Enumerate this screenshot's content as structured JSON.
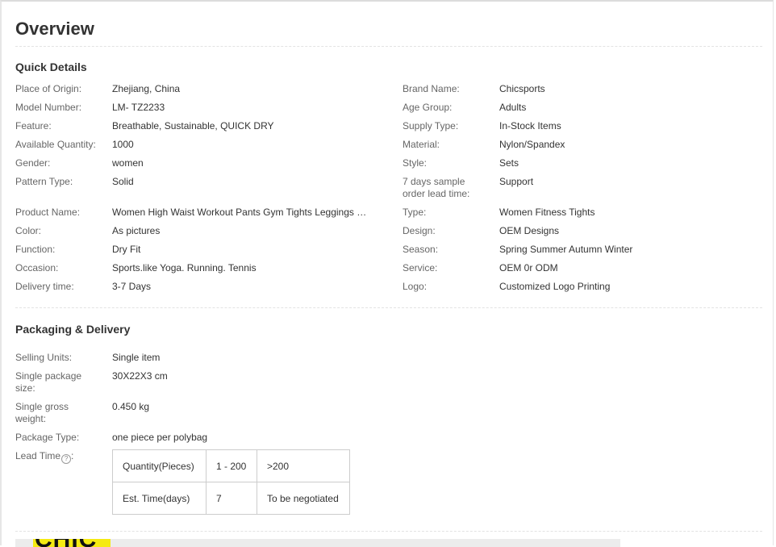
{
  "title": "Overview",
  "quick_details": {
    "heading": "Quick Details",
    "left": [
      {
        "label": "Place of Origin:",
        "value": "Zhejiang, China"
      },
      {
        "label": "Model Number:",
        "value": "LM- TZ2233"
      },
      {
        "label": "Feature:",
        "value": "Breathable, Sustainable, QUICK DRY"
      },
      {
        "label": "Available Quantity:",
        "value": "1000"
      },
      {
        "label": "Gender:",
        "value": "women"
      },
      {
        "label": "Pattern Type:",
        "value": "Solid"
      },
      {
        "label": "Product Name:",
        "value": "Women High Waist Workout Pants Gym Tights Leggings With Pocket"
      },
      {
        "label": "Color:",
        "value": "As pictures"
      },
      {
        "label": "Function:",
        "value": "Dry Fit"
      },
      {
        "label": "Occasion:",
        "value": "Sports.like Yoga. Running. Tennis"
      },
      {
        "label": "Delivery time:",
        "value": "3-7 Days"
      }
    ],
    "right": [
      {
        "label": "Brand Name:",
        "value": "Chicsports"
      },
      {
        "label": "Age Group:",
        "value": "Adults"
      },
      {
        "label": "Supply Type:",
        "value": "In-Stock Items"
      },
      {
        "label": "Material:",
        "value": "Nylon/Spandex"
      },
      {
        "label": "Style:",
        "value": "Sets"
      },
      {
        "label": "7 days sample order lead time:",
        "value": "Support"
      },
      {
        "label": "Type:",
        "value": "Women Fitness Tights"
      },
      {
        "label": "Design:",
        "value": "OEM Designs"
      },
      {
        "label": "Season:",
        "value": "Spring Summer Autumn Winter"
      },
      {
        "label": "Service:",
        "value": "OEM 0r ODM"
      },
      {
        "label": "Logo:",
        "value": "Customized Logo Printing"
      }
    ]
  },
  "packaging": {
    "heading": "Packaging & Delivery",
    "items": [
      {
        "label": "Selling Units:",
        "value": "Single item"
      },
      {
        "label": "Single package size:",
        "value": "30X22X3 cm"
      },
      {
        "label": "Single gross weight:",
        "value": "0.450 kg"
      },
      {
        "label": "Package Type:",
        "value": "one piece per polybag"
      }
    ],
    "lead_time": {
      "label": "Lead Time",
      "help_glyph": "?",
      "rows": [
        [
          "Quantity(Pieces)",
          "1 - 200",
          ">200"
        ],
        [
          "Est. Time(days)",
          "7",
          "To be negotiated"
        ]
      ]
    }
  },
  "banner": {
    "logo_text": "CHIC",
    "logo_color": "#f5ea12"
  }
}
